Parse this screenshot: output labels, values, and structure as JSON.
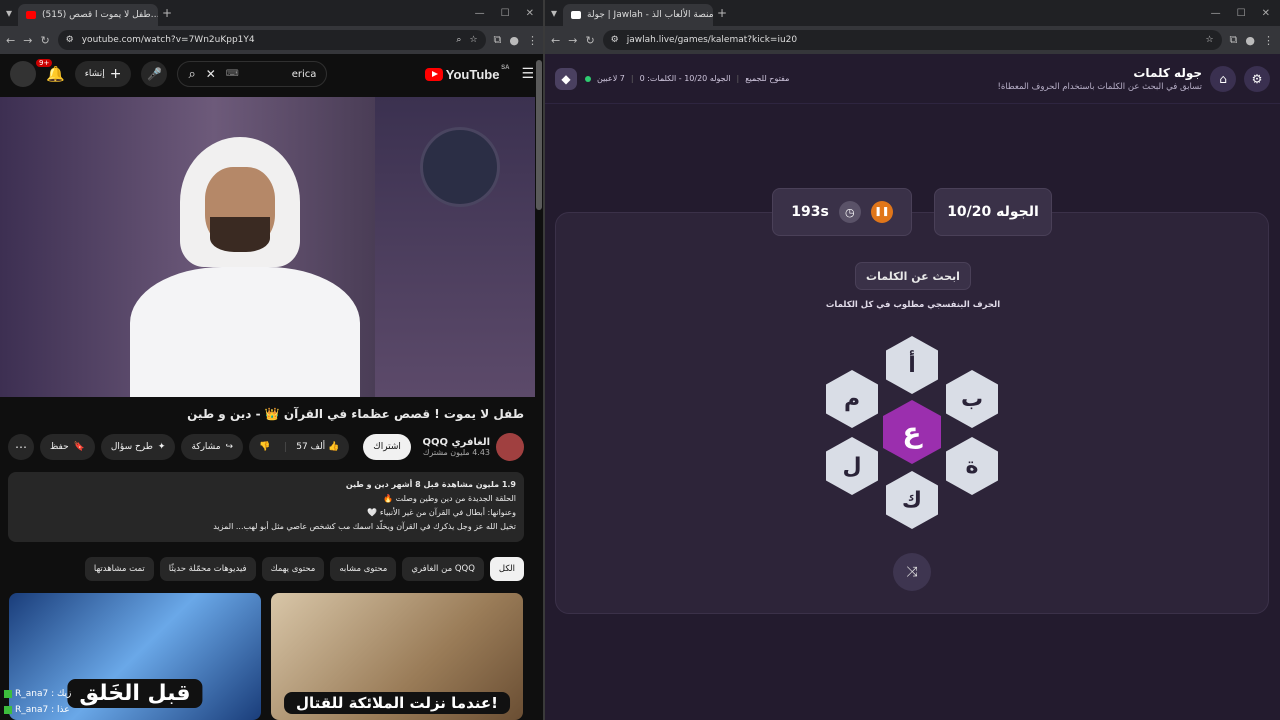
{
  "left_browser": {
    "tab_title": "(515) طفل لا يموت ا قصص…",
    "url": "youtube.com/watch?v=7Wn2uKpp1Y4"
  },
  "youtube": {
    "logo_text": "YouTube",
    "region": "SA",
    "search_value": "erica",
    "create_label": "إنشاء",
    "notif_count": "9+",
    "video_title": "طفل لا يموت ! قصص عظماء في القرآن 👑 - دين و طين",
    "channel_name": "الغافري QQQ",
    "subscribers": "4.43 مليون مشترك",
    "subscribe_label": "اشتراك",
    "likes": "57 ألف",
    "share_label": "مشاركة",
    "ask_label": "طرح سؤال",
    "save_label": "حفظ",
    "desc_line1": "1.9 مليون مشاهدة  قبل 8 أشهر  دين و طين",
    "desc_line2": "الحلقة الجديدة من دين وطين وصلت 🔥",
    "desc_line3": "وعنوانها: أبطال في القرآن من غير الأنبياء 🤍",
    "desc_line4": "تخيل الله عز وجل يذكرك في القرآن ويخلّد اسمك مب كشخص عاصي مثل أبو لهب...  المزيد",
    "chips": [
      "الكل",
      "من الغافري QQQ",
      "محتوى مشابه",
      "محتوى يهمك",
      "فيديوهات محمّلة حديثًا",
      "تمت مشاهدتها"
    ],
    "thumb1_text": "قبل الخَلق",
    "thumb2_text": "عندما نزلت الملائكة للقتال!",
    "chat1": "R_ana7 : زيك",
    "chat2": "R_ana7 : عذا"
  },
  "right_browser": {
    "tab_title": "جولة | Jawlah - منصة الألعاب الذ…",
    "url": "jawlah.live/games/kalemat?kick=iu20"
  },
  "jawlah": {
    "title": "جوله كلمات",
    "subtitle": "تسابق في البحث عن الكلمات باستخدام الحروف المعطاة!",
    "players": "7 لاعبين",
    "round_info": "الجوله 10/20 - الكلمات: 0",
    "open_label": "مفتوح للجميع",
    "round_card": "الجوله 10/20",
    "timer": "193s",
    "find_label": "ابحث عن الكلمات",
    "hint": "الحرف البنفسجي مطلوب في كل الكلمات",
    "center_letter": "ع",
    "letters": {
      "top": "أ",
      "top_right": "ب",
      "bottom_right": "ة",
      "bottom": "ك",
      "bottom_left": "ل",
      "top_left": "م"
    },
    "accent": "#9b2fae"
  }
}
